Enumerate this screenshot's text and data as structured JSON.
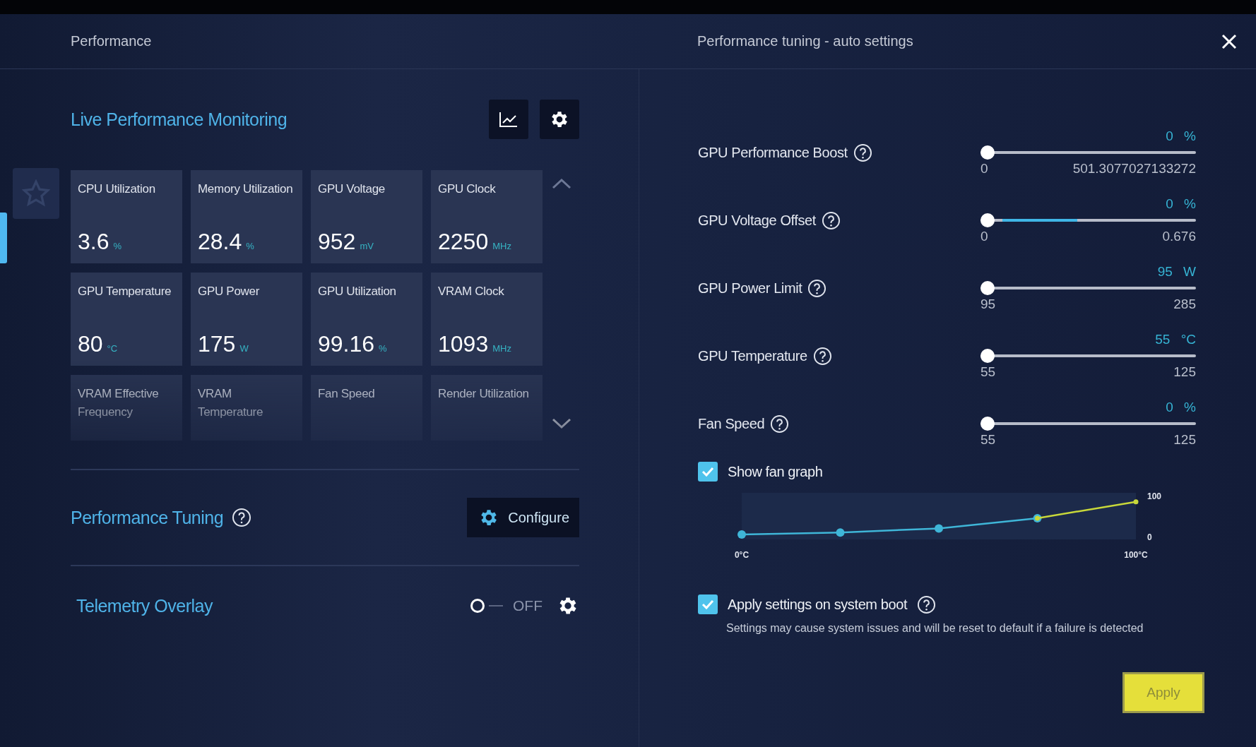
{
  "window": {
    "title": "Performance",
    "panel_title": "Performance tuning - auto settings"
  },
  "monitoring": {
    "title": "Live Performance Monitoring",
    "tiles": [
      {
        "label": "CPU Utilization",
        "value": "3.6",
        "unit": "%"
      },
      {
        "label": "Memory Utilization",
        "value": "28.4",
        "unit": "%"
      },
      {
        "label": "GPU Voltage",
        "value": "952",
        "unit": "mV"
      },
      {
        "label": "GPU Clock",
        "value": "2250",
        "unit": "MHz"
      },
      {
        "label": "GPU Temperature",
        "value": "80",
        "unit": "°C"
      },
      {
        "label": "GPU Power",
        "value": "175",
        "unit": "W"
      },
      {
        "label": "GPU Utilization",
        "value": "99.16",
        "unit": "%"
      },
      {
        "label": "VRAM Clock",
        "value": "1093",
        "unit": "MHz"
      },
      {
        "label": "VRAM Effective Frequency"
      },
      {
        "label": "VRAM Temperature"
      },
      {
        "label": "Fan Speed"
      },
      {
        "label": "Render Utilization"
      }
    ]
  },
  "tuning": {
    "title": "Performance Tuning",
    "button": "Configure"
  },
  "telemetry": {
    "title": "Telemetry Overlay",
    "on": false,
    "state_label": "OFF"
  },
  "sliders": [
    {
      "label": "GPU Performance Boost",
      "value": "0",
      "unit": "%",
      "min": "0",
      "max": "501.3077027133272",
      "level": 0,
      "kind": "plain"
    },
    {
      "label": "GPU Voltage Offset",
      "value": "0",
      "unit": "%",
      "min": "0",
      "max": "0.676",
      "level": 0,
      "kind": "accent"
    },
    {
      "label": "GPU Power Limit",
      "value": "95",
      "unit": "W",
      "min": "95",
      "max": "285",
      "level": 0,
      "kind": "plain"
    },
    {
      "label": "GPU Temperature",
      "value": "55",
      "unit": "°C",
      "min": "55",
      "max": "125",
      "level": 0,
      "kind": "plain"
    },
    {
      "label": "Fan Speed",
      "value": "0",
      "unit": "%",
      "min": "55",
      "max": "125",
      "level": 0,
      "kind": "plain"
    }
  ],
  "fan_graph": {
    "label": "Show fan graph",
    "checked": true,
    "chart_data": {
      "type": "line",
      "x": [
        0,
        25,
        50,
        75,
        100
      ],
      "series": [
        {
          "color": "#3fb6d8",
          "marker": "circle",
          "values": [
            5,
            10,
            20,
            45,
            null
          ]
        },
        {
          "color": "#c8d83a",
          "marker": "circle",
          "values": [
            null,
            null,
            null,
            45,
            85
          ]
        }
      ],
      "xlim": [
        0,
        100
      ],
      "ylim": [
        0,
        100
      ],
      "xticks": [
        {
          "value": 0,
          "label": "0°C"
        },
        {
          "value": 100,
          "label": "100°C"
        }
      ],
      "yticks": [
        0,
        100
      ]
    }
  },
  "boot": {
    "label": "Apply settings on system boot",
    "checked": true,
    "note": "Settings may cause system issues and will be reset to default if a failure is detected"
  },
  "apply_button": "Apply"
}
